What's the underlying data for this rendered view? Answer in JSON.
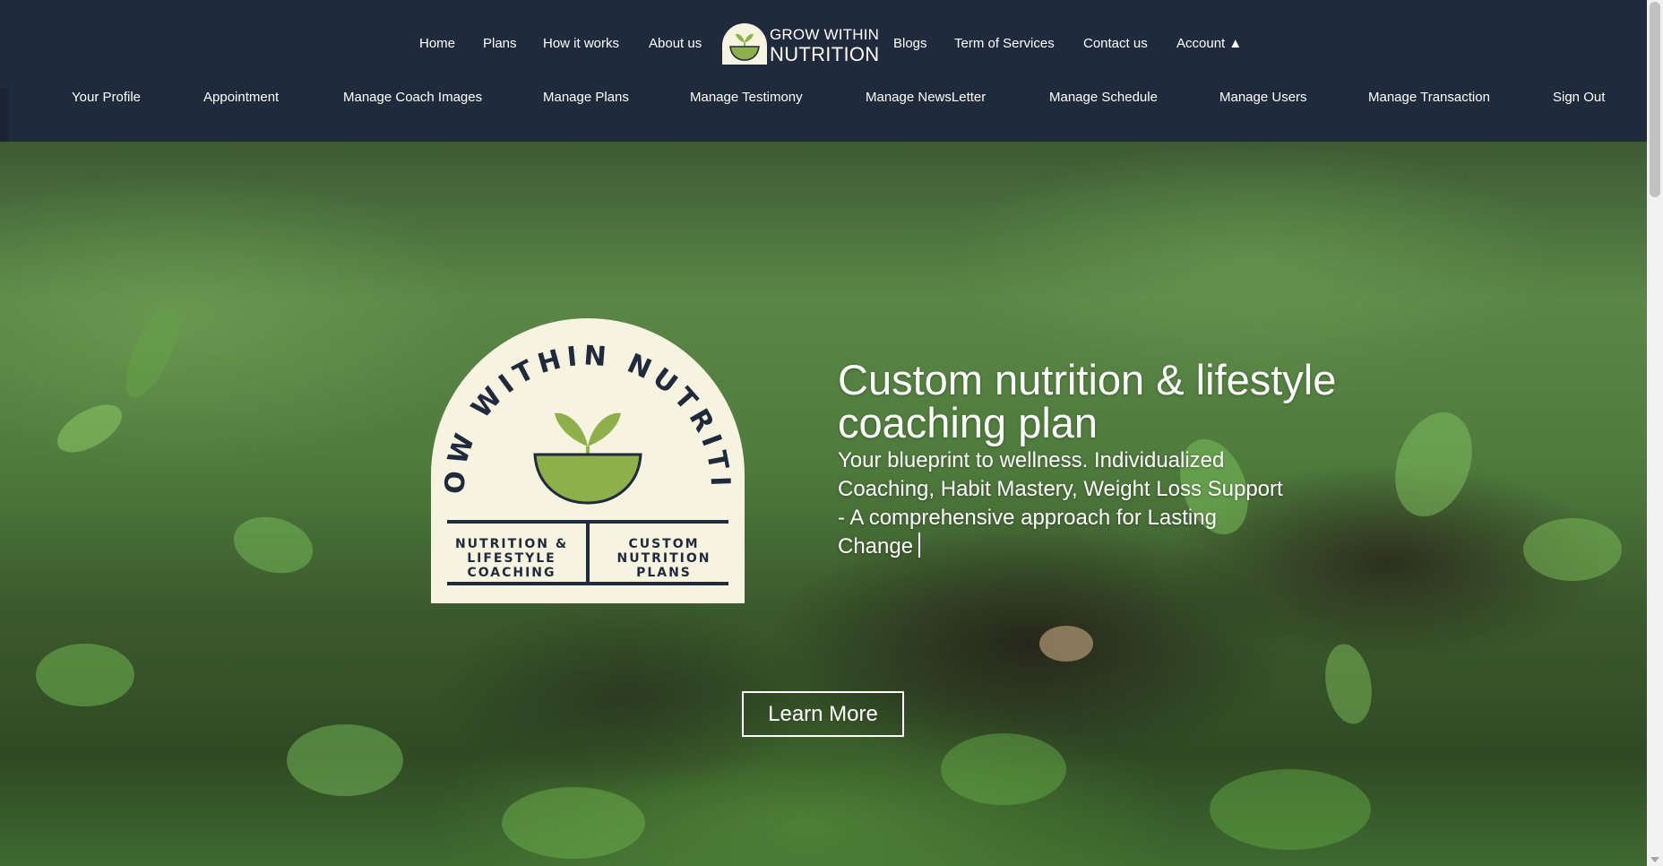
{
  "topnav": {
    "items": [
      "Home",
      "Plans",
      "How it works",
      "About us",
      "Blogs",
      "Term of Services",
      "Contact us",
      "Account"
    ],
    "account_caret": "▲",
    "brand": {
      "line1": "GROW WITHIN",
      "line2": "NUTRITION"
    }
  },
  "subnav": {
    "items": [
      "Your Profile",
      "Appointment",
      "Manage Coach Images",
      "Manage Plans",
      "Manage Testimony",
      "Manage NewsLetter",
      "Manage Schedule",
      "Manage Users",
      "Manage Transaction",
      "Sign Out"
    ]
  },
  "hero": {
    "logo": {
      "arc_text": "GROW WITHIN NUTRITION",
      "left_text": "NUTRITION & LIFESTYLE COACHING",
      "right_text": "CUSTOM NUTRITION PLANS"
    },
    "title": "Custom nutrition & lifestyle coaching plan",
    "subtitle": "Your blueprint to wellness. Individualized Coaching, Habit Mastery, Weight Loss Support - A comprehensive approach for Lasting Change",
    "cta": "Learn More"
  },
  "colors": {
    "header_bg": "#1f2a3c",
    "logo_cream": "#f6f3e0",
    "logo_green": "#8db04a",
    "logo_dark": "#1f2a3c"
  }
}
